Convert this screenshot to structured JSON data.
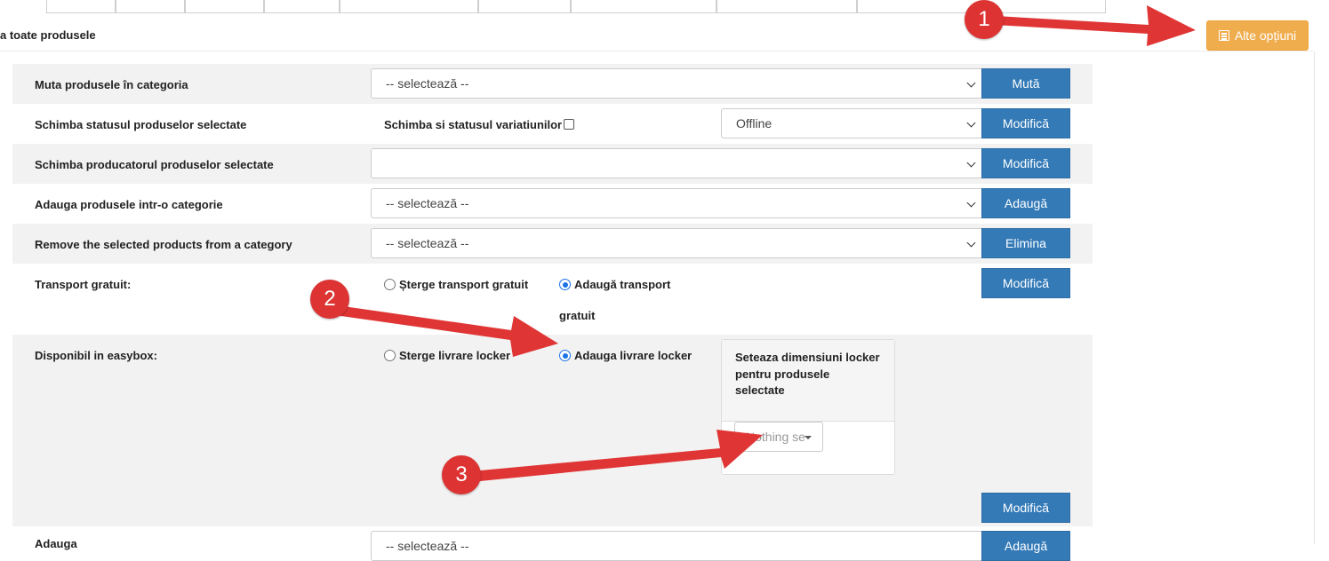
{
  "header": {
    "title": "a toate produsele",
    "options_button": "Alte opțiuni",
    "options_icon": "list-icon"
  },
  "rows": {
    "move": {
      "label": "Muta produsele în categoria",
      "select_value": "-- selectează --",
      "button": "Mută"
    },
    "status": {
      "label": "Schimba statusul produselor selectate",
      "checkbox_label": "Schimba si statusul variatiunilor",
      "select_value": "Offline",
      "button": "Modifică"
    },
    "producer": {
      "label": "Schimba producatorul produselor selectate",
      "select_value": "",
      "button": "Modifică"
    },
    "add_category": {
      "label": "Adauga produsele intr-o categorie",
      "select_value": "-- selectează --",
      "button": "Adaugă"
    },
    "remove_category": {
      "label": "Remove the selected products from a category",
      "select_value": "-- selectează --",
      "button": "Elimina"
    },
    "free_shipping": {
      "label": "Transport gratuit:",
      "option_remove": "Șterge transport gratuit",
      "option_add_line1": "Adaugă transport",
      "option_add_line2": "gratuit",
      "button": "Modifică"
    },
    "easybox": {
      "label": "Disponibil in easybox:",
      "option_remove": "Sterge livrare locker",
      "option_add": "Adauga livrare locker",
      "panel_title_line1": "Seteaza dimensiuni locker",
      "panel_title_line2": "pentru produsele",
      "panel_title_line3": "selectate",
      "dropdown_placeholder": "Nothing se",
      "button": "Modifică"
    },
    "partial": {
      "label": "Adauga",
      "select_value": "-- selectează --",
      "button": "Adaugă"
    }
  },
  "annotations": [
    "1",
    "2",
    "3"
  ],
  "colors": {
    "primary": "#337ab7",
    "warning": "#f0ad4e",
    "annotation": "#dd3333",
    "row_gray": "#f2f2f2"
  }
}
